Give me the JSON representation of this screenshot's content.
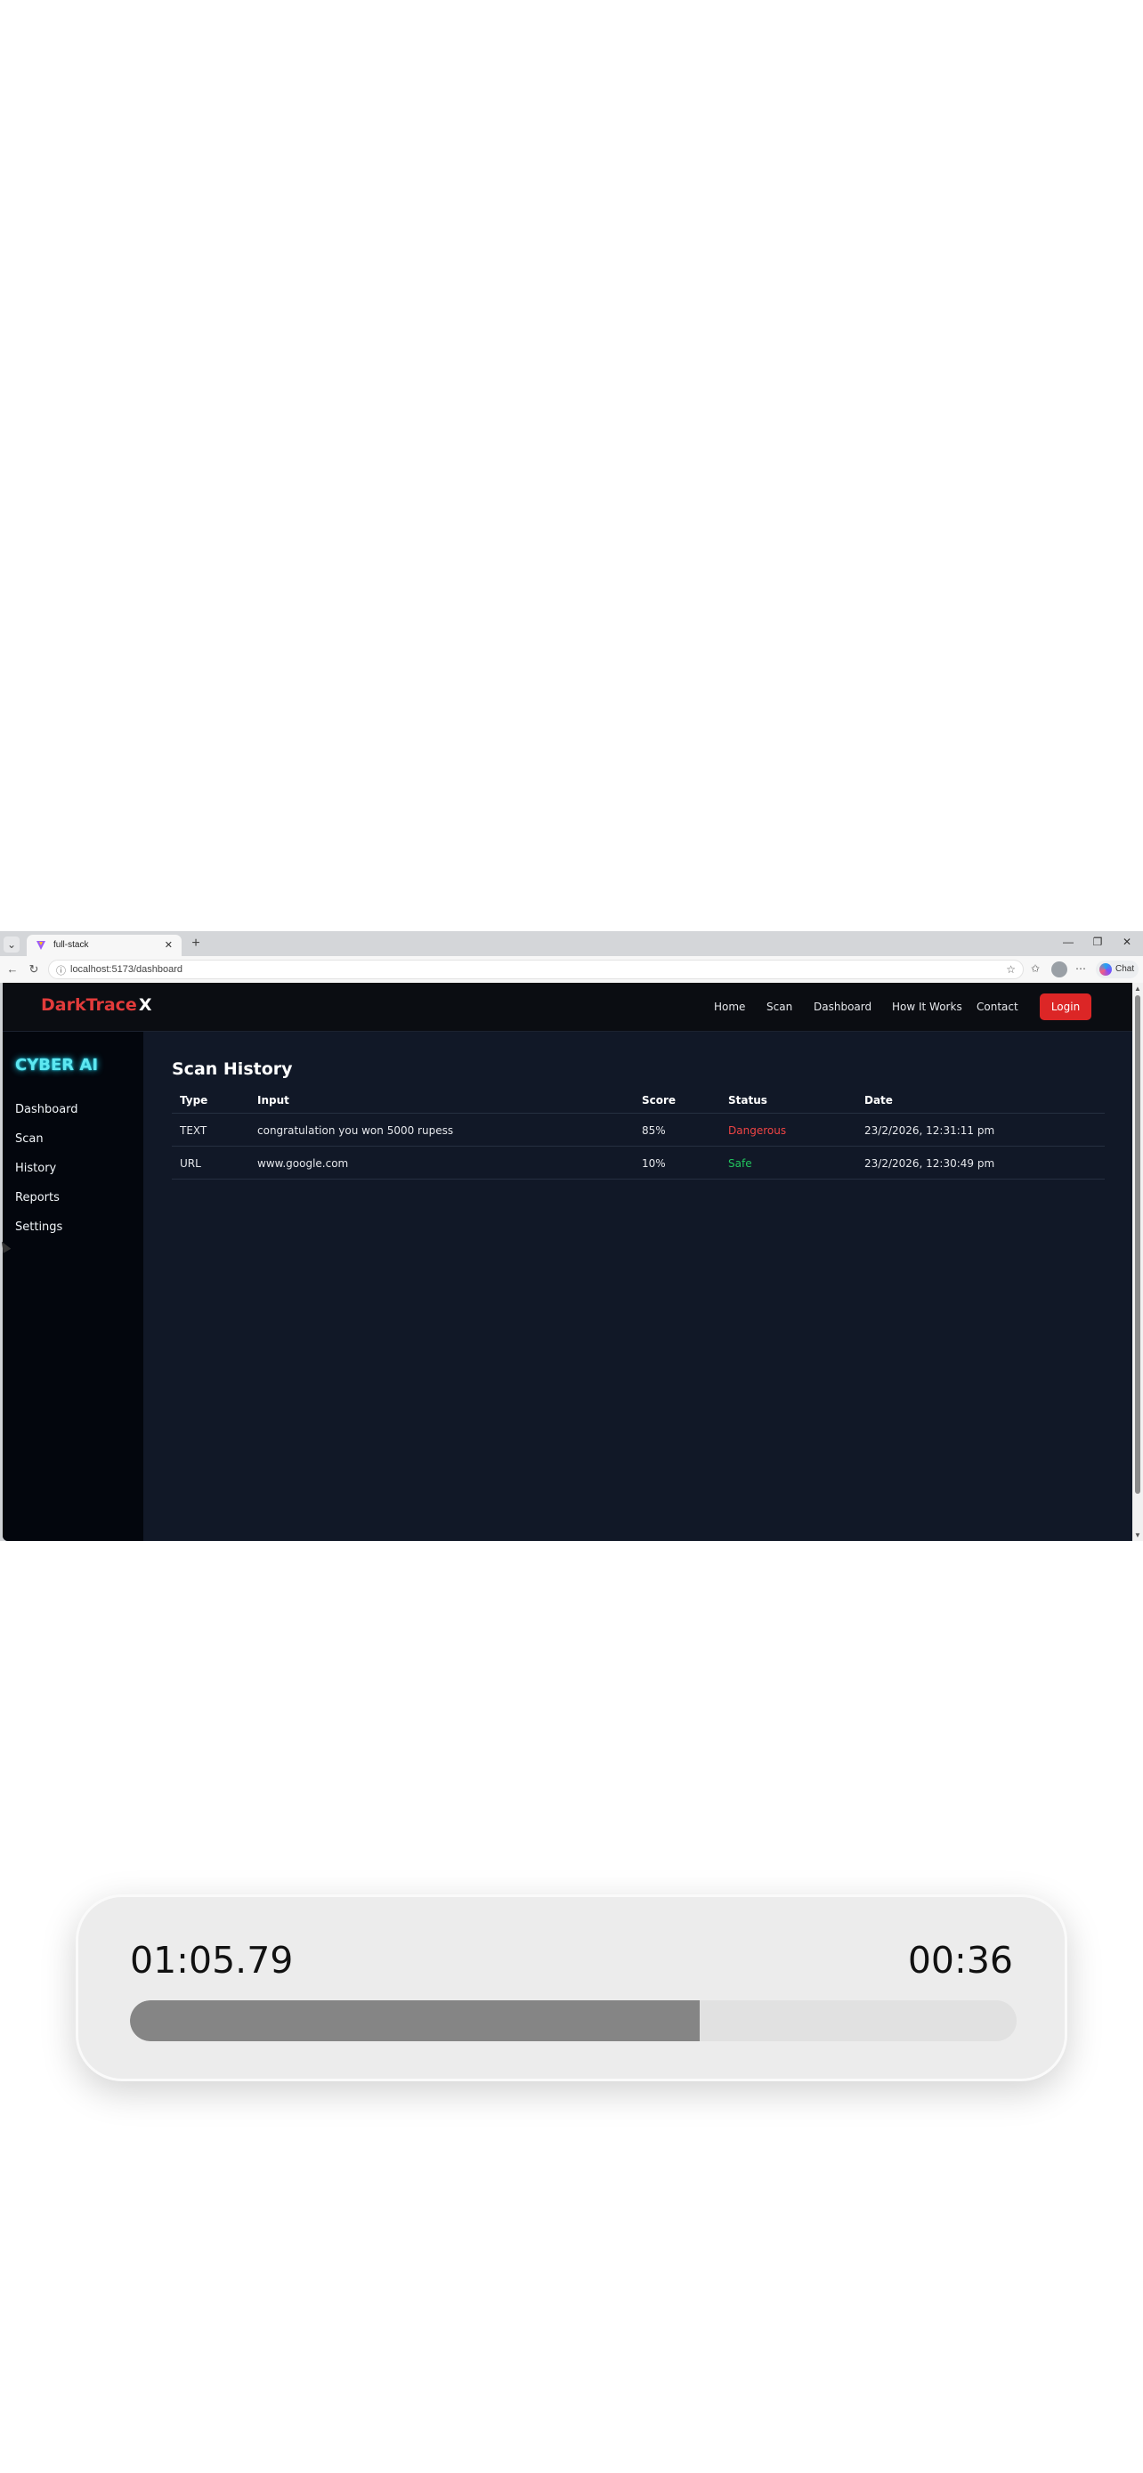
{
  "browser": {
    "tab_title": "full-stack",
    "tab_close": "✕",
    "new_tab": "+",
    "window_controls": [
      "—",
      "❐",
      "✕"
    ],
    "url": "localhost:5173/dashboard",
    "copilot_label": "Chat",
    "icons": [
      "back-icon",
      "refresh-icon",
      "site-info-icon",
      "star-icon",
      "favorites-icon",
      "profile-icon",
      "more-icon",
      "copilot-icon"
    ]
  },
  "app": {
    "brand": "DarkTrace",
    "brand_suffix": "X",
    "nav": [
      "Home",
      "Scan",
      "Dashboard",
      "How It Works",
      "Contact"
    ],
    "login_label": "Login",
    "sidebar": {
      "title": "CYBER AI",
      "items": [
        "Dashboard",
        "Scan",
        "History",
        "Reports",
        "Settings"
      ]
    },
    "history": {
      "title": "Scan History",
      "columns": [
        "Type",
        "Input",
        "Score",
        "Status",
        "Date"
      ],
      "rows": [
        {
          "type": "TEXT",
          "input": "congratulation you won 5000 rupess",
          "score": "85%",
          "status": "Dangerous",
          "date": "23/2/2026, 12:31:11 pm"
        },
        {
          "type": "URL",
          "input": "www.google.com",
          "score": "10%",
          "status": "Safe",
          "date": "23/2/2026, 12:30:49 pm"
        }
      ]
    },
    "colors": {
      "accent": "#dc2626",
      "neon": "#22d3ee",
      "danger": "#ef4444",
      "safe": "#22c55e",
      "background": "#111827"
    }
  },
  "player": {
    "elapsed": "01:05.79",
    "remaining": "00:36",
    "progress_fraction": 0.643
  }
}
